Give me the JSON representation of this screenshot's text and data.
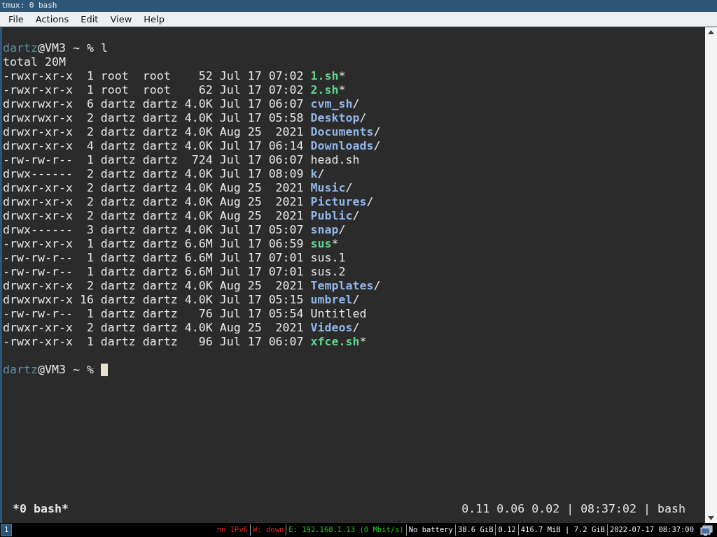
{
  "window": {
    "title": "tmux: 0 bash"
  },
  "menu": [
    "File",
    "Actions",
    "Edit",
    "View",
    "Help"
  ],
  "terminal": {
    "prompt": {
      "user": "dartz",
      "rest": "@VM3 ~ % ",
      "command": "l"
    },
    "total": "total 20M",
    "listing": [
      {
        "info": "-rwxr-xr-x  1 root  root    52 Jul 17 07:02",
        "name": "1.sh",
        "suffix": "*",
        "kind": "exec"
      },
      {
        "info": "-rwxr-xr-x  1 root  root    62 Jul 17 07:02",
        "name": "2.sh",
        "suffix": "*",
        "kind": "exec"
      },
      {
        "info": "drwxrwxr-x  6 dartz dartz 4.0K Jul 17 06:07",
        "name": "cvm_sh",
        "suffix": "/",
        "kind": "dir"
      },
      {
        "info": "drwxrwxr-x  2 dartz dartz 4.0K Jul 17 05:58",
        "name": "Desktop",
        "suffix": "/",
        "kind": "dir"
      },
      {
        "info": "drwxr-xr-x  2 dartz dartz 4.0K Aug 25  2021",
        "name": "Documents",
        "suffix": "/",
        "kind": "dir"
      },
      {
        "info": "drwxr-xr-x  4 dartz dartz 4.0K Jul 17 06:14",
        "name": "Downloads",
        "suffix": "/",
        "kind": "dir"
      },
      {
        "info": "-rw-rw-r--  1 dartz dartz  724 Jul 17 06:07",
        "name": "head.sh",
        "kind": "file"
      },
      {
        "info": "drwx------  2 dartz dartz 4.0K Jul 17 08:09",
        "name": "k",
        "suffix": "/",
        "kind": "dir"
      },
      {
        "info": "drwxr-xr-x  2 dartz dartz 4.0K Aug 25  2021",
        "name": "Music",
        "suffix": "/",
        "kind": "dir"
      },
      {
        "info": "drwxr-xr-x  2 dartz dartz 4.0K Aug 25  2021",
        "name": "Pictures",
        "suffix": "/",
        "kind": "dir"
      },
      {
        "info": "drwxr-xr-x  2 dartz dartz 4.0K Aug 25  2021",
        "name": "Public",
        "suffix": "/",
        "kind": "dir"
      },
      {
        "info": "drwx------  3 dartz dartz 4.0K Jul 17 05:07",
        "name": "snap",
        "suffix": "/",
        "kind": "dir"
      },
      {
        "info": "-rwxr-xr-x  1 dartz dartz 6.6M Jul 17 06:59",
        "name": "sus",
        "suffix": "*",
        "kind": "exec"
      },
      {
        "info": "-rw-rw-r--  1 dartz dartz 6.6M Jul 17 07:01",
        "name": "sus.1",
        "kind": "file"
      },
      {
        "info": "-rw-rw-r--  1 dartz dartz 6.6M Jul 17 07:01",
        "name": "sus.2",
        "kind": "file"
      },
      {
        "info": "drwxr-xr-x  2 dartz dartz 4.0K Aug 25  2021",
        "name": "Templates",
        "suffix": "/",
        "kind": "dir"
      },
      {
        "info": "drwxrwxr-x 16 dartz dartz 4.0K Jul 17 05:15",
        "name": "umbrel",
        "suffix": "/",
        "kind": "dir"
      },
      {
        "info": "-rw-rw-r--  1 dartz dartz   76 Jul 17 05:54",
        "name": "Untitled",
        "kind": "file"
      },
      {
        "info": "drwxr-xr-x  2 dartz dartz 4.0K Aug 25  2021",
        "name": "Videos",
        "suffix": "/",
        "kind": "dir"
      },
      {
        "info": "-rwxr-xr-x  1 dartz dartz   96 Jul 17 06:07",
        "name": "xfce.sh",
        "suffix": "*",
        "kind": "exec"
      }
    ],
    "prompt2": {
      "user": "dartz",
      "rest": "@VM3 ~ % "
    },
    "tmux_status": {
      "window": "*0 bash*",
      "right": "0.11 0.06 0.02 | 08:37:02 | bash"
    }
  },
  "taskbar": {
    "workspace": {
      "label": "1",
      "selected": true
    },
    "status": [
      {
        "text": "no IPv6",
        "color": "#e02020"
      },
      {
        "text": "W: down",
        "color": "#e02020"
      },
      {
        "text": "E: 192.168.1.13 (0 Mbit/s)",
        "color": "#22cc22"
      },
      {
        "text": "No battery"
      },
      {
        "text": "38.6 GiB"
      },
      {
        "text": "0.12"
      },
      {
        "text": "416.7 MiB | 7.2 GiB"
      },
      {
        "text": "2022-07-17 08:37:00"
      }
    ]
  }
}
